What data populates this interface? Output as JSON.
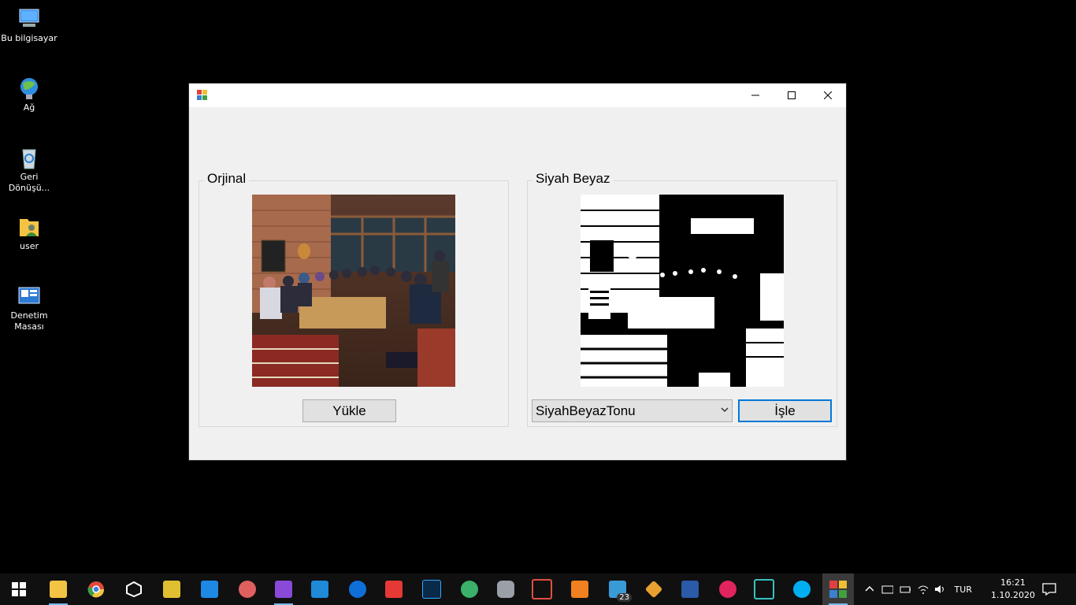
{
  "desktop": {
    "icons": [
      {
        "label": "Bu bilgisayar",
        "icon": "computer-icon"
      },
      {
        "label": "Ağ",
        "icon": "network-icon"
      },
      {
        "label": "Geri Dönüşü...",
        "icon": "recycle-bin-icon"
      },
      {
        "label": "user",
        "icon": "user-folder-icon"
      },
      {
        "label": "Denetim Masası",
        "icon": "control-panel-icon"
      }
    ]
  },
  "window": {
    "group_left_title": "Orjinal",
    "group_right_title": "Siyah Beyaz",
    "load_button": "Yükle",
    "filter_select_value": "SiyahBeyazTonu",
    "process_button": "İşle"
  },
  "taskbar": {
    "apps": [
      "start-icon",
      "file-explorer-icon",
      "chrome-icon",
      "unity-icon",
      "sourcetree-icon",
      "whatsapp-icon",
      "paint-icon",
      "visual-studio-icon",
      "vscode-icon",
      "teamviewer-icon",
      "anydesk-icon",
      "photoshop-icon",
      "android-studio-icon",
      "database-icon",
      "phone-icon",
      "xampp-icon",
      "notepad-icon",
      "git-icon",
      "virtualbox-icon",
      "flickr-icon",
      "terminal-icon",
      "skype-icon",
      "winforms-app-icon"
    ],
    "badge": "23",
    "language": "TUR",
    "time": "16:21",
    "date": "1.10.2020"
  },
  "colors": {
    "accent": "#0078d7",
    "taskbar": "#101010"
  }
}
